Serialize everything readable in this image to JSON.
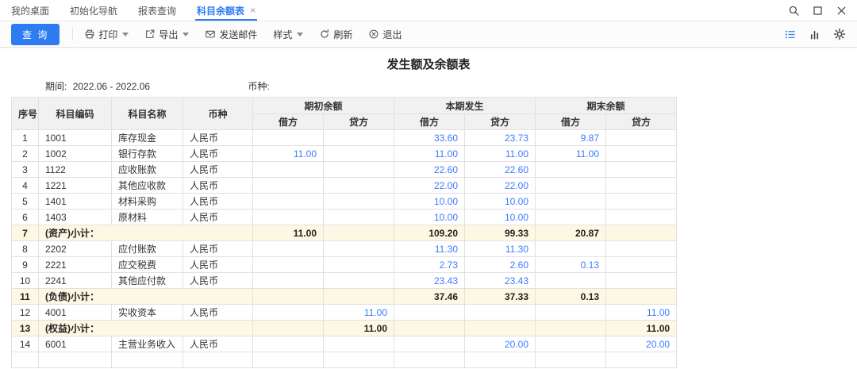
{
  "colors": {
    "accent": "#2e7cf2",
    "number": "#3b7bff",
    "subtotal_bg": "#fdf8e3"
  },
  "icons": {
    "search": "magnifier",
    "maximize": "square",
    "close": "x",
    "tab_close": "×",
    "print": "printer",
    "export": "arrow-out-of-box",
    "email": "envelope",
    "caret": "triangle-down",
    "refresh": "circular-arrow",
    "exit": "circle-x",
    "list_view": "bulleted-list",
    "chart_view": "bar-chart",
    "settings": "gear"
  },
  "tabs": {
    "items": [
      {
        "label": "我的桌面",
        "active": false
      },
      {
        "label": "初始化导航",
        "active": false
      },
      {
        "label": "报表查询",
        "active": false
      },
      {
        "label": "科目余额表",
        "active": true,
        "close_glyph": "×"
      }
    ]
  },
  "toolbar": {
    "query_label": "查 询",
    "print_label": "打印",
    "export_label": "导出",
    "email_label": "发送邮件",
    "style_label": "样式",
    "refresh_label": "刷新",
    "exit_label": "退出"
  },
  "report": {
    "title": "发生额及余额表",
    "period_label": "期间:",
    "period_value": "2022.06 - 2022.06",
    "currency_label": "币种:"
  },
  "table": {
    "headers": {
      "seq": "序号",
      "code": "科目编码",
      "name": "科目名称",
      "currency": "币种",
      "opening": "期初余额",
      "current": "本期发生",
      "ending": "期末余额",
      "debit": "借方",
      "credit": "贷方"
    },
    "rows": [
      {
        "seq": "1",
        "code": "1001",
        "name": "库存现金",
        "currency": "人民币",
        "ob_d": "",
        "ob_c": "",
        "cp_d": "33.60",
        "cp_c": "23.73",
        "eb_d": "9.87",
        "eb_c": "",
        "subtotal": false
      },
      {
        "seq": "2",
        "code": "1002",
        "name": "银行存款",
        "currency": "人民币",
        "ob_d": "11.00",
        "ob_c": "",
        "cp_d": "11.00",
        "cp_c": "11.00",
        "eb_d": "11.00",
        "eb_c": "",
        "subtotal": false
      },
      {
        "seq": "3",
        "code": "1122",
        "name": "应收账款",
        "currency": "人民币",
        "ob_d": "",
        "ob_c": "",
        "cp_d": "22.60",
        "cp_c": "22.60",
        "eb_d": "",
        "eb_c": "",
        "subtotal": false
      },
      {
        "seq": "4",
        "code": "1221",
        "name": "其他应收款",
        "currency": "人民币",
        "ob_d": "",
        "ob_c": "",
        "cp_d": "22.00",
        "cp_c": "22.00",
        "eb_d": "",
        "eb_c": "",
        "subtotal": false
      },
      {
        "seq": "5",
        "code": "1401",
        "name": "材料采购",
        "currency": "人民币",
        "ob_d": "",
        "ob_c": "",
        "cp_d": "10.00",
        "cp_c": "10.00",
        "eb_d": "",
        "eb_c": "",
        "subtotal": false
      },
      {
        "seq": "6",
        "code": "1403",
        "name": "原材料",
        "currency": "人民币",
        "ob_d": "",
        "ob_c": "",
        "cp_d": "10.00",
        "cp_c": "10.00",
        "eb_d": "",
        "eb_c": "",
        "subtotal": false
      },
      {
        "seq": "7",
        "label": "(资产)小计：",
        "ob_d": "11.00",
        "ob_c": "",
        "cp_d": "109.20",
        "cp_c": "99.33",
        "eb_d": "20.87",
        "eb_c": "",
        "subtotal": true
      },
      {
        "seq": "8",
        "code": "2202",
        "name": "应付账款",
        "currency": "人民币",
        "ob_d": "",
        "ob_c": "",
        "cp_d": "11.30",
        "cp_c": "11.30",
        "eb_d": "",
        "eb_c": "",
        "subtotal": false
      },
      {
        "seq": "9",
        "code": "2221",
        "name": "应交税费",
        "currency": "人民币",
        "ob_d": "",
        "ob_c": "",
        "cp_d": "2.73",
        "cp_c": "2.60",
        "eb_d": "0.13",
        "eb_c": "",
        "subtotal": false
      },
      {
        "seq": "10",
        "code": "2241",
        "name": "其他应付款",
        "currency": "人民币",
        "ob_d": "",
        "ob_c": "",
        "cp_d": "23.43",
        "cp_c": "23.43",
        "eb_d": "",
        "eb_c": "",
        "subtotal": false
      },
      {
        "seq": "11",
        "label": "(负债)小计：",
        "ob_d": "",
        "ob_c": "",
        "cp_d": "37.46",
        "cp_c": "37.33",
        "eb_d": "0.13",
        "eb_c": "",
        "subtotal": true
      },
      {
        "seq": "12",
        "code": "4001",
        "name": "实收资本",
        "currency": "人民币",
        "ob_d": "",
        "ob_c": "11.00",
        "cp_d": "",
        "cp_c": "",
        "eb_d": "",
        "eb_c": "11.00",
        "subtotal": false
      },
      {
        "seq": "13",
        "label": "(权益)小计：",
        "ob_d": "",
        "ob_c": "11.00",
        "cp_d": "",
        "cp_c": "",
        "eb_d": "",
        "eb_c": "11.00",
        "subtotal": true
      },
      {
        "seq": "14",
        "code": "6001",
        "name": "主营业务收入",
        "currency": "人民币",
        "ob_d": "",
        "ob_c": "",
        "cp_d": "",
        "cp_c": "20.00",
        "eb_d": "",
        "eb_c": "20.00",
        "subtotal": false
      },
      {
        "seq": "",
        "code": "",
        "name": "",
        "currency": "",
        "ob_d": "",
        "ob_c": "",
        "cp_d": "",
        "cp_c": "",
        "eb_d": "",
        "eb_c": "",
        "subtotal": false
      }
    ]
  }
}
